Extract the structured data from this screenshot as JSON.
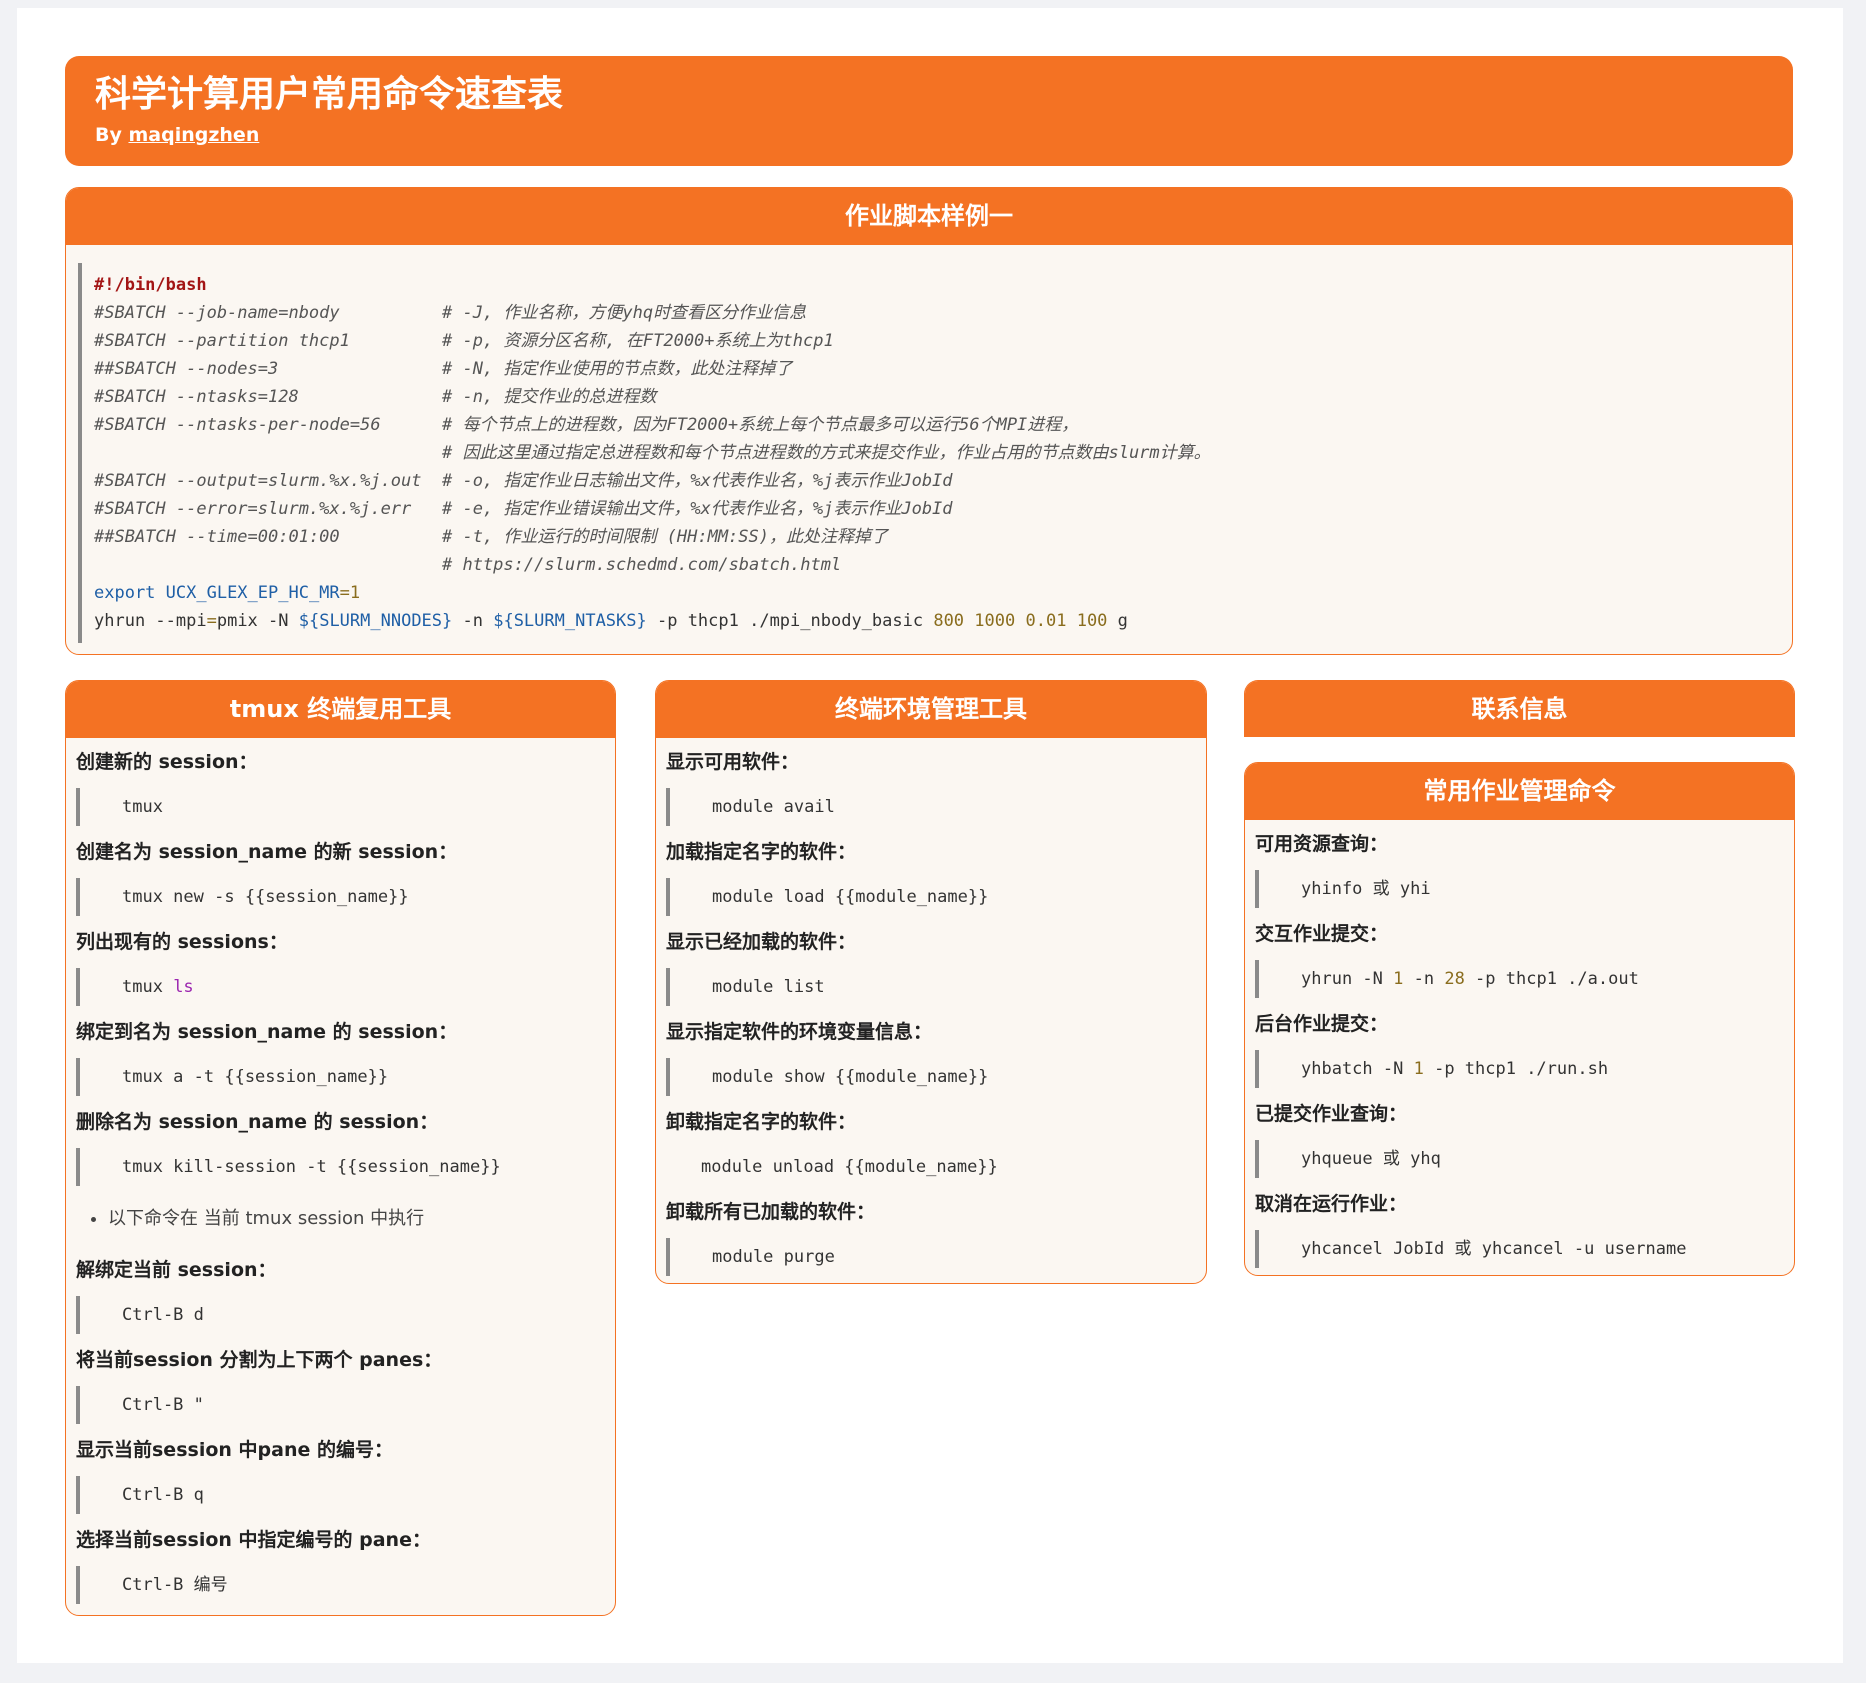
{
  "header": {
    "title": "科学计算用户常用命令速查表",
    "by_prefix": "By ",
    "author": "maqingzhen"
  },
  "script_card": {
    "title": "作业脚本样例一",
    "shebang": "#!/bin/bash",
    "lines": [
      {
        "directive": "#SBATCH --job-name=nbody          ",
        "comment": "# -J, 作业名称，方便yhq时查看区分作业信息"
      },
      {
        "directive": "#SBATCH --partition thcp1         ",
        "comment": "# -p, 资源分区名称, 在FT2000+系统上为thcp1"
      },
      {
        "directive": "##SBATCH --nodes=3                ",
        "comment": "# -N, 指定作业使用的节点数，此处注释掉了"
      },
      {
        "directive": "#SBATCH --ntasks=128              ",
        "comment": "# -n, 提交作业的总进程数"
      },
      {
        "directive": "#SBATCH --ntasks-per-node=56      ",
        "comment": "# 每个节点上的进程数，因为FT2000+系统上每个节点最多可以运行56个MPI进程，"
      },
      {
        "directive": "                                  ",
        "comment": "# 因此这里通过指定总进程数和每个节点进程数的方式来提交作业，作业占用的节点数由slurm计算。"
      },
      {
        "directive": "#SBATCH --output=slurm.%x.%j.out  ",
        "comment": "# -o, 指定作业日志输出文件，%x代表作业名，%j表示作业JobId"
      },
      {
        "directive": "#SBATCH --error=slurm.%x.%j.err   ",
        "comment": "# -e, 指定作业错误输出文件，%x代表作业名，%j表示作业JobId"
      },
      {
        "directive": "##SBATCH --time=00:01:00          ",
        "comment": "# -t, 作业运行的时间限制 (HH:MM:SS)，此处注释掉了"
      },
      {
        "directive": "                                  ",
        "comment": "# https://slurm.schedmd.com/sbatch.html"
      }
    ],
    "export_kw": "export ",
    "export_var": "UCX_GLEX_EP_HC_MR",
    "export_eq": "=",
    "export_val": "1",
    "run_a": "yhrun --mpi",
    "run_eq": "=",
    "run_b": "pmix -N ",
    "run_var1": "${SLURM_NNODES}",
    "run_c": " -n ",
    "run_var2": "${SLURM_NTASKS}",
    "run_d": " -p thcp1 ./mpi_nbody_basic ",
    "run_n1": "800",
    "run_n2": "1000",
    "run_n3": "0.01",
    "run_n4": "100",
    "run_e": " g"
  },
  "tmux": {
    "title": "tmux 终端复用工具",
    "items": [
      {
        "label": "创建新的 session：",
        "cmd": "tmux"
      },
      {
        "label": "创建名为 session_name 的新 session：",
        "cmd": "tmux new -s {{session_name}}"
      },
      {
        "label": "列出现有的 sessions：",
        "cmd_a": "tmux ",
        "cmd_b": "ls"
      },
      {
        "label": "绑定到名为 session_name 的 session：",
        "cmd": "tmux a -t {{session_name}}"
      },
      {
        "label": "删除名为 session_name 的 session：",
        "cmd": "tmux kill-session -t {{session_name}}"
      }
    ],
    "note": "以下命令在 当前 tmux session 中执行",
    "items2": [
      {
        "label": "解绑定当前 session：",
        "cmd": "Ctrl-B d"
      },
      {
        "label": "将当前session 分割为上下两个 panes：",
        "cmd": "Ctrl-B \""
      },
      {
        "label": "显示当前session 中pane 的编号：",
        "cmd": "Ctrl-B q"
      },
      {
        "label": "选择当前session 中指定编号的 pane：",
        "cmd": "Ctrl-B 编号"
      }
    ]
  },
  "module": {
    "title": "终端环境管理工具",
    "items": [
      {
        "label": "显示可用软件：",
        "cmd": "module avail"
      },
      {
        "label": "加载指定名字的软件：",
        "cmd": "module load {{module_name}}"
      },
      {
        "label": "显示已经加载的软件：",
        "cmd": "module list"
      },
      {
        "label": "显示指定软件的环境变量信息：",
        "cmd": "module show {{module_name}}"
      },
      {
        "label": "卸载指定名字的软件：",
        "cmd": "module unload {{module_name}}"
      },
      {
        "label": "卸载所有已加载的软件：",
        "cmd": "module purge"
      }
    ]
  },
  "contact": {
    "title": "联系信息"
  },
  "jobs": {
    "title": "常用作业管理命令",
    "items": [
      {
        "label": "可用资源查询：",
        "cmd": "yhinfo 或 yhi"
      },
      {
        "label": "交互作业提交：",
        "cmd_a": "yhrun -N ",
        "n1": "1",
        "cmd_b": " -n ",
        "n2": "28",
        "cmd_c": " -p thcp1 ./a.out"
      },
      {
        "label": "后台作业提交：",
        "cmd_a": "yhbatch -N ",
        "n1": "1",
        "cmd_b": " -p thcp1 ./run.sh"
      },
      {
        "label": "已提交作业查询：",
        "cmd": "yhqueue 或 yhq"
      },
      {
        "label": "取消在运行作业：",
        "cmd": "yhcancel JobId 或 yhcancel -u username"
      }
    ]
  }
}
